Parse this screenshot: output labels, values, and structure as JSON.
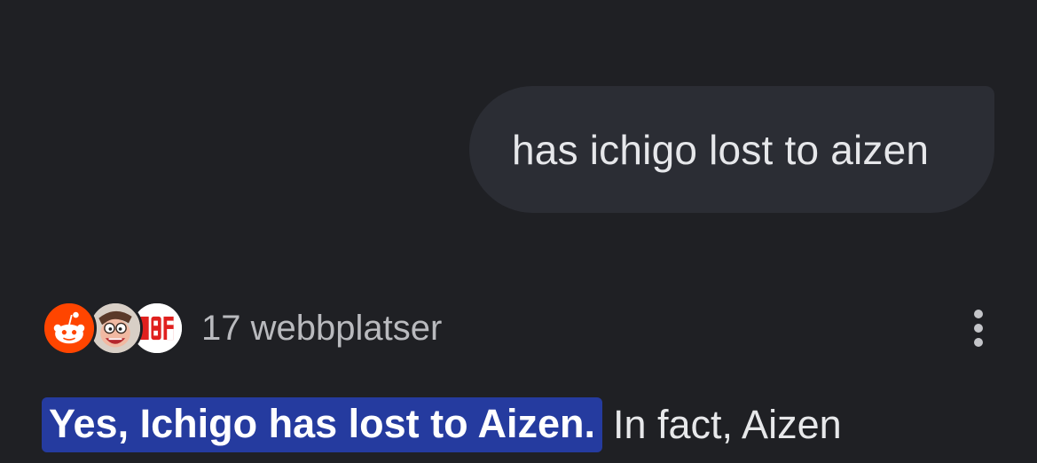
{
  "user_message": {
    "text": "has ichigo lost to aizen"
  },
  "sources": {
    "count_label": "17 webbplatser",
    "favicons": [
      {
        "name": "reddit-icon"
      },
      {
        "name": "cartoon-avatar-icon"
      },
      {
        "name": "ibf-logo-icon",
        "logo_text": "IBF"
      }
    ]
  },
  "menu": {
    "icon": "more-vert-icon"
  },
  "answer": {
    "highlighted": "Yes, Ichigo has lost to Aizen.",
    "continuation": "In fact, Aizen"
  },
  "colors": {
    "background": "#1f2024",
    "bubble": "#2b2d34",
    "highlight": "#253b9f",
    "reddit": "#ff4500"
  }
}
